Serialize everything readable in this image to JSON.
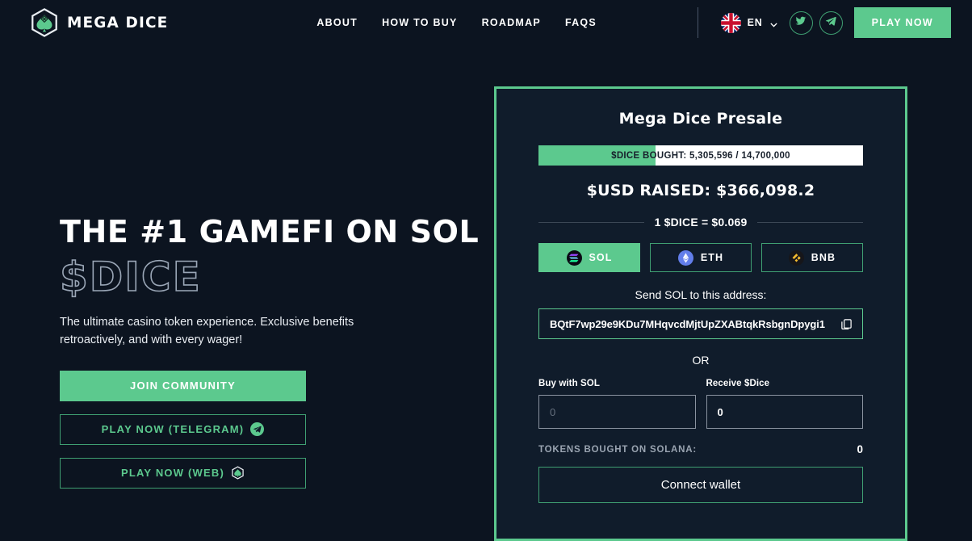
{
  "header": {
    "brand_name": "MEGA DICE",
    "logo_icon": "hexagon-spade-icon",
    "nav": [
      {
        "label": "ABOUT"
      },
      {
        "label": "HOW TO BUY"
      },
      {
        "label": "ROADMAP"
      },
      {
        "label": "FAQS"
      }
    ],
    "language": {
      "code": "EN",
      "flag_icon": "uk-flag-icon",
      "chevron_icon": "chevron-down-icon"
    },
    "socials": [
      {
        "name": "twitter-icon"
      },
      {
        "name": "telegram-icon"
      }
    ],
    "play_now_label": "PLAY NOW"
  },
  "hero": {
    "title": "THE #1 GAMEFI ON SOL",
    "token": "$DICE",
    "description": "The ultimate casino token experience. Exclusive benefits retroactively, and with every wager!",
    "buttons": [
      {
        "label": "JOIN COMMUNITY",
        "style": "filled",
        "icon": ""
      },
      {
        "label": "PLAY NOW (TELEGRAM)",
        "style": "outline",
        "icon": "telegram-icon"
      },
      {
        "label": "PLAY NOW (WEB)",
        "style": "outline",
        "icon": "hexagon-spade-icon"
      }
    ]
  },
  "presale": {
    "title": "Mega Dice Presale",
    "progress": {
      "label": "$DICE BOUGHT: 5,305,596 / 14,700,000",
      "bought": 5305596,
      "total": 14700000,
      "percent": 36.1
    },
    "usd_raised": "$USD RAISED: $366,098.2",
    "rate": "1 $DICE = $0.069",
    "coins": [
      {
        "label": "SOL",
        "icon": "solana-icon",
        "active": true
      },
      {
        "label": "ETH",
        "icon": "ethereum-icon",
        "active": false
      },
      {
        "label": "BNB",
        "icon": "binance-icon",
        "active": false
      }
    ],
    "send_label": "Send SOL to this address:",
    "address": "BQtF7wp29e9KDu7MHqvcdMjtUpZXABtqkRsbgnDpygi1",
    "copy_icon": "copy-icon",
    "or_label": "OR",
    "buy_field": {
      "label": "Buy with SOL",
      "value": "",
      "placeholder": "0"
    },
    "receive_field": {
      "label": "Receive $Dice",
      "value": "0",
      "placeholder": "0"
    },
    "tokens_label": "TOKENS BOUGHT ON SOLANA:",
    "tokens_value": "0",
    "connect_label": "Connect wallet"
  },
  "colors": {
    "background": "#0c1420",
    "card": "#101c2b",
    "accent": "#5cc98e",
    "accent_border": "#3f9f72",
    "text": "#ffffff",
    "muted": "#9aa4b1"
  }
}
